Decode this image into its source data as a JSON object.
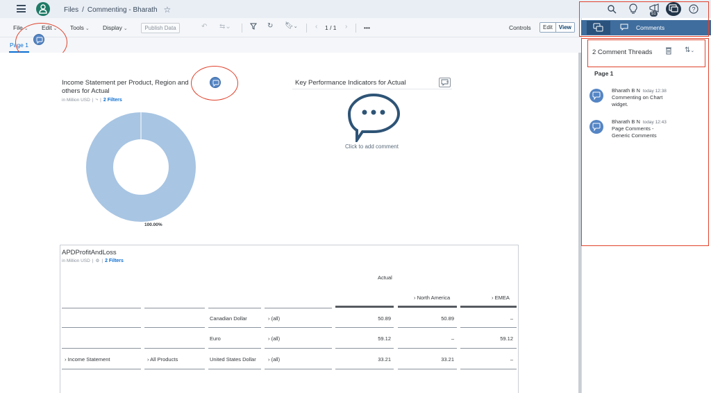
{
  "shell": {
    "breadcrumb_root": "Files",
    "breadcrumb_sep": "/",
    "breadcrumb_current": "Commenting - Bharath",
    "notification_count": "51"
  },
  "toolbar": {
    "file": "File",
    "edit": "Edit",
    "tools": "Tools",
    "display": "Display",
    "publish": "Publish Data",
    "page_indicator": "1 / 1",
    "more": "•••",
    "controls": "Controls",
    "mode_edit": "Edit",
    "mode_view": "View"
  },
  "page": {
    "tab": "Page 1"
  },
  "widgets": {
    "income": {
      "title_line1": "Income Statement per Product, Region and",
      "title_line2": "others for Actual",
      "unit": "in Million USD",
      "filters": "2 Filters"
    },
    "kpi": {
      "title": "Key Performance Indicators for Actual",
      "add_prompt": "Click to add comment"
    },
    "table": {
      "title": "APDProfitAndLoss",
      "unit": "in Million USD",
      "filters": "2 Filters",
      "header_actual": "Actual",
      "header_na": "North America",
      "header_emea": "EMEA",
      "rows": [
        {
          "account": "",
          "product": "",
          "currency": "Canadian Dollar",
          "region": "(all)",
          "actual": "50.89",
          "na": "50.89",
          "emea": "–"
        },
        {
          "account": "",
          "product": "",
          "currency": "Euro",
          "region": "(all)",
          "actual": "59.12",
          "na": "–",
          "emea": "59.12"
        },
        {
          "account": "Income Statement",
          "product": "All Products",
          "currency": "United States Dollar",
          "region": "(all)",
          "actual": "33.21",
          "na": "33.21",
          "emea": "–"
        }
      ]
    }
  },
  "chart_data": {
    "type": "pie",
    "categories": [
      ""
    ],
    "values": [
      100
    ],
    "data_labels": [
      "100.00%"
    ],
    "colors": [
      "#a8c5e3"
    ]
  },
  "side_panel": {
    "tab_label": "Comments",
    "threads_title": "2 Comment Threads",
    "page_heading": "Page 1",
    "comments": [
      {
        "author": "Bharath B N",
        "time": "today 12:38",
        "line1": "Commenting on Chart",
        "line2": "widget."
      },
      {
        "author": "Bharath B N",
        "time": "today 12:43",
        "line1": "Page Comments -",
        "line2": "Generic Comments"
      }
    ]
  },
  "colors": {
    "accent": "#0a6ed1",
    "annotation_red": "#e0412b",
    "comment_blue": "#5585c4",
    "side_header": "#3f6d9e"
  }
}
